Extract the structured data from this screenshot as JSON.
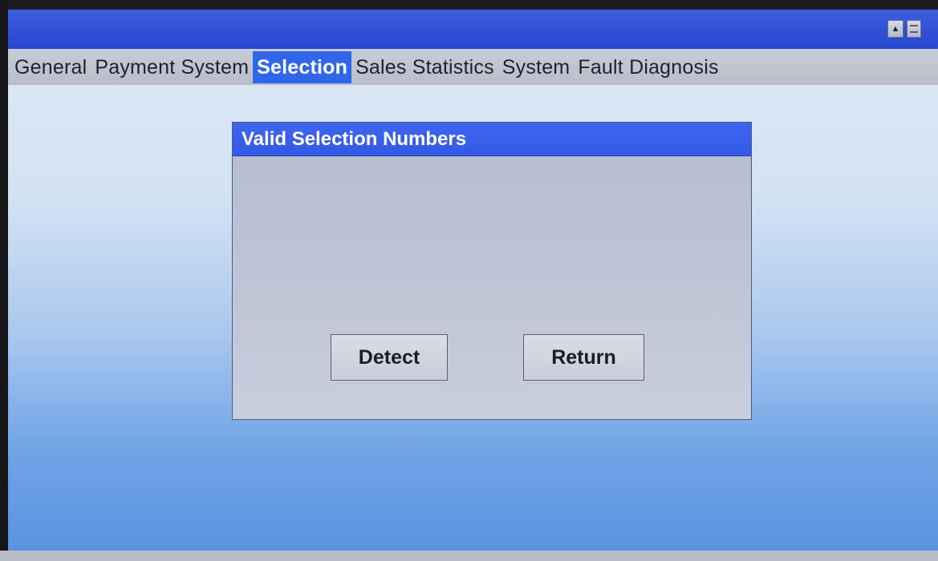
{
  "title_bar": {
    "controls": [
      {
        "icon": "triangle-up-icon",
        "glyph": "▲"
      },
      {
        "icon": "menu-icon"
      }
    ]
  },
  "tabs": [
    {
      "label": "General",
      "active": false
    },
    {
      "label": "Payment System",
      "active": false
    },
    {
      "label": "Selection",
      "active": true
    },
    {
      "label": "Sales Statistics",
      "active": false
    },
    {
      "label": "System",
      "active": false
    },
    {
      "label": "Fault Diagnosis",
      "active": false
    }
  ],
  "dialog": {
    "title": "Valid Selection Numbers",
    "buttons": {
      "detect": "Detect",
      "return": "Return"
    }
  },
  "colors": {
    "title_bar": "#3051d8",
    "active_tab": "#2f66ea",
    "dialog_header": "#3a60ec",
    "tab_bar": "#bfc5cf"
  }
}
